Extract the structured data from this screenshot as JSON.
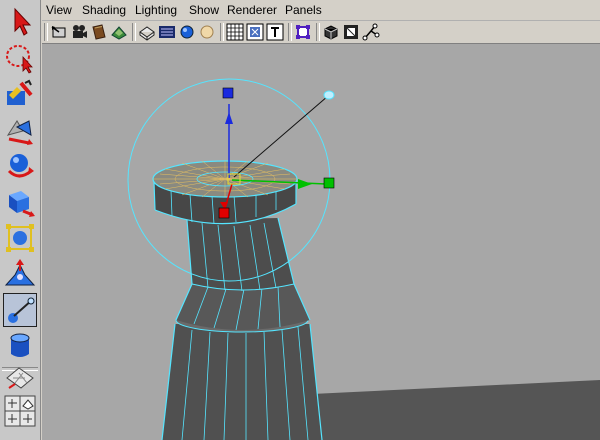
{
  "menubar": {
    "items": [
      "View",
      "Shading",
      "Lighting",
      "Show",
      "Renderer",
      "Panels"
    ]
  },
  "toolbox": {
    "tools": [
      {
        "name": "select-tool-icon"
      },
      {
        "name": "lasso-tool-icon"
      },
      {
        "name": "paint-select-tool-icon"
      },
      {
        "name": "move-tool-icon"
      },
      {
        "name": "rotate-tool-icon"
      },
      {
        "name": "scale-tool-icon"
      },
      {
        "name": "universal-manipulator-icon"
      },
      {
        "name": "soft-modification-tool-icon"
      },
      {
        "name": "show-manipulator-tool-icon",
        "active": true
      },
      {
        "name": "last-tool-used-icon"
      },
      {
        "name": "single-perspective-layout-icon"
      },
      {
        "name": "four-view-layout-icon"
      }
    ]
  },
  "iconbar": {
    "icons": [
      "select-camera-icon",
      "camera-attributes-icon",
      "bookmarks-icon",
      "image-plane-icon",
      "wireframe-shading-icon",
      "smooth-shading-icon",
      "textured-shading-icon",
      "use-lights-icon",
      "grid-icon",
      "resolution-gate-icon",
      "safe-title-icon",
      "isolate-select-icon",
      "xray-icon",
      "backface-icon",
      "hud-icon"
    ]
  },
  "colors": {
    "viewport_bg": "#a7a7a7",
    "wire_highlight": "#55e5ff",
    "manip_x": "#00c000",
    "manip_y": "#1a2adf",
    "manip_z": "#e00000"
  }
}
